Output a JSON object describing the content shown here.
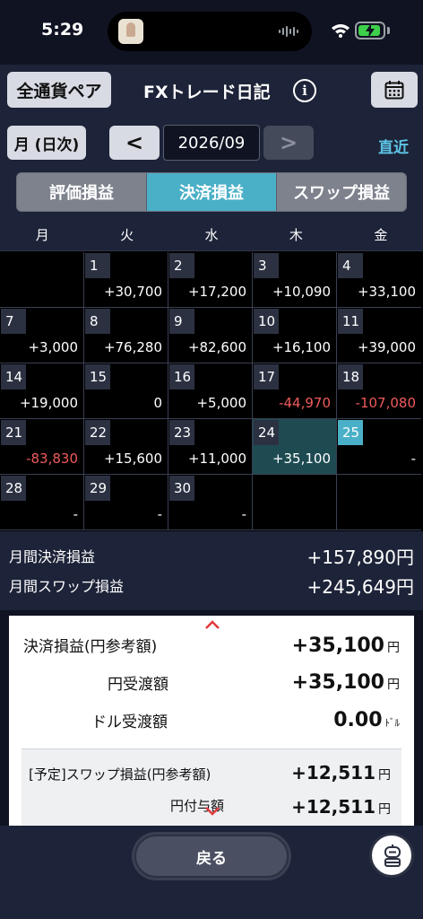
{
  "status_bar": {
    "time": "5:29"
  },
  "header": {
    "pair_button": "全通貨ペア",
    "title": "FXトレード日記",
    "info_icon": "i"
  },
  "month_nav": {
    "mode_button": "月 (日次)",
    "prev": "<",
    "month": "2026/09",
    "next": ">",
    "latest": "直近"
  },
  "tabs": [
    {
      "label": "評価損益",
      "active": false
    },
    {
      "label": "決済損益",
      "active": true
    },
    {
      "label": "スワップ損益",
      "active": false
    }
  ],
  "weekdays": [
    "月",
    "火",
    "水",
    "木",
    "金"
  ],
  "calendar": [
    {
      "day": "",
      "value": ""
    },
    {
      "day": "1",
      "value": "+30,700"
    },
    {
      "day": "2",
      "value": "+17,200"
    },
    {
      "day": "3",
      "value": "+10,090"
    },
    {
      "day": "4",
      "value": "+33,100"
    },
    {
      "day": "7",
      "value": "+3,000"
    },
    {
      "day": "8",
      "value": "+76,280"
    },
    {
      "day": "9",
      "value": "+82,600"
    },
    {
      "day": "10",
      "value": "+16,100"
    },
    {
      "day": "11",
      "value": "+39,000"
    },
    {
      "day": "14",
      "value": "+19,000"
    },
    {
      "day": "15",
      "value": "0"
    },
    {
      "day": "16",
      "value": "+5,000"
    },
    {
      "day": "17",
      "value": "-44,970"
    },
    {
      "day": "18",
      "value": "-107,080"
    },
    {
      "day": "21",
      "value": "-83,830"
    },
    {
      "day": "22",
      "value": "+15,600"
    },
    {
      "day": "23",
      "value": "+11,000"
    },
    {
      "day": "24",
      "value": "+35,100"
    },
    {
      "day": "25",
      "value": "-"
    },
    {
      "day": "28",
      "value": "-"
    },
    {
      "day": "29",
      "value": "-"
    },
    {
      "day": "30",
      "value": "-"
    },
    {
      "day": "",
      "value": ""
    },
    {
      "day": "",
      "value": ""
    }
  ],
  "selected_day": "24",
  "today_day": "25",
  "summary": {
    "settled_label": "月間決済損益",
    "settled_value": "+157,890円",
    "swap_label": "月間スワップ損益",
    "swap_value": "+245,649円"
  },
  "detail": {
    "settled_label": "決済損益(円参考額)",
    "settled_amount": "+35,100",
    "settled_unit": "円",
    "yen_label": "円受渡額",
    "yen_amount": "+35,100",
    "yen_unit": "円",
    "usd_label": "ドル受渡額",
    "usd_amount": "0.00",
    "usd_unit": "ﾄﾞﾙ",
    "swap_label": "[予定]スワップ損益(円参考額)",
    "swap_amount": "+12,511",
    "swap_unit": "円",
    "yen_grant_label": "円付与額",
    "yen_grant_amount": "+12,511",
    "yen_grant_unit": "円"
  },
  "bottom": {
    "back_label": "戻る"
  },
  "colors": {
    "accent": "#4ab0c7",
    "negative": "#f05a5a",
    "link": "#5ec4e6",
    "background": "#0f1322",
    "panel": "#1d2338"
  }
}
